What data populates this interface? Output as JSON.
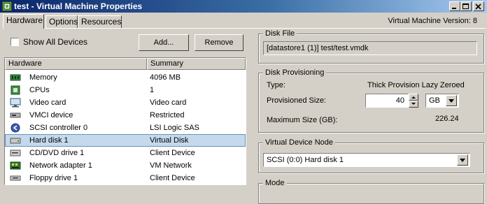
{
  "window": {
    "title": "test - Virtual Machine Properties"
  },
  "tabs": [
    {
      "label": "Hardware"
    },
    {
      "label": "Options"
    },
    {
      "label": "Resources"
    }
  ],
  "vm_version": "Virtual Machine Version: 8",
  "show_all_devices": {
    "label": "Show All Devices",
    "checked": false
  },
  "buttons": {
    "add": "Add...",
    "remove": "Remove"
  },
  "hardware_list": {
    "col_hardware": "Hardware",
    "col_summary": "Summary",
    "selected_index": 5,
    "rows": [
      {
        "name": "Memory",
        "summary": "4096 MB",
        "icon": "memory-icon"
      },
      {
        "name": "CPUs",
        "summary": "1",
        "icon": "cpu-icon"
      },
      {
        "name": "Video card",
        "summary": "Video card",
        "icon": "monitor-icon"
      },
      {
        "name": "VMCI device",
        "summary": "Restricted",
        "icon": "vmci-device-icon"
      },
      {
        "name": "SCSI controller 0",
        "summary": "LSI Logic SAS",
        "icon": "scsi-controller-icon"
      },
      {
        "name": "Hard disk 1",
        "summary": "Virtual Disk",
        "icon": "hard-disk-icon"
      },
      {
        "name": "CD/DVD drive 1",
        "summary": "Client Device",
        "icon": "cd-dvd-icon"
      },
      {
        "name": "Network adapter 1",
        "summary": "VM Network",
        "icon": "network-adapter-icon"
      },
      {
        "name": "Floppy drive 1",
        "summary": "Client Device",
        "icon": "floppy-icon"
      }
    ]
  },
  "disk_file": {
    "label": "Disk File",
    "path": "[datastore1 (1)] test/test.vmdk"
  },
  "disk_provisioning": {
    "label": "Disk Provisioning",
    "type_label": "Type:",
    "type_value": "Thick Provision Lazy Zeroed",
    "provisioned_label": "Provisioned Size:",
    "provisioned_value": "40",
    "unit": "GB",
    "max_label": "Maximum Size (GB):",
    "max_value": "226.24"
  },
  "virtual_device_node": {
    "label": "Virtual Device Node",
    "value": "SCSI (0:0) Hard disk 1"
  },
  "mode": {
    "label": "Mode"
  },
  "colors": {
    "titlebar_start": "#0a246a",
    "selection": "#c5d9ec"
  }
}
